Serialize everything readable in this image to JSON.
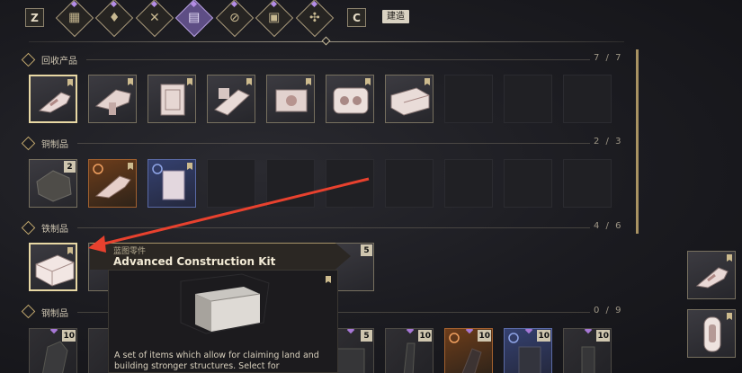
{
  "topbar": {
    "key_left": "Z",
    "key_right": "C",
    "active_label": "建造",
    "tabs": [
      {
        "icon": "grid-icon",
        "glyph": "▦",
        "active": false
      },
      {
        "icon": "drop-icon",
        "glyph": "♦",
        "active": false
      },
      {
        "icon": "tools-icon",
        "glyph": "✕",
        "active": false
      },
      {
        "icon": "bricks-icon",
        "glyph": "▤",
        "active": true
      },
      {
        "icon": "recycle-icon",
        "glyph": "⊘",
        "active": false
      },
      {
        "icon": "crate-icon",
        "glyph": "▣",
        "active": false
      },
      {
        "icon": "molecule-icon",
        "glyph": "✣",
        "active": false
      }
    ]
  },
  "sections": [
    {
      "label": "回收产品",
      "count": "7 / 7"
    },
    {
      "label": "铜制品",
      "count": "2 / 3"
    },
    {
      "label": "铁制品",
      "count": "4 / 6"
    },
    {
      "label": "钢制品",
      "count": "0 / 9"
    }
  ],
  "slot_counts": {
    "copper_first": "2",
    "iron_fourth": "5",
    "steel": [
      "10",
      "10",
      "10",
      "10",
      "5",
      "10",
      "10",
      "10",
      "10"
    ]
  },
  "tooltip": {
    "category": "蓝图零件",
    "title": "Advanced Construction Kit",
    "description": "A set of items which allow for claiming land and building stronger structures. Select for"
  },
  "colors": {
    "accent_gold": "#c2a86e",
    "active_tab": "#5e4e85",
    "arrow": "#e8412e"
  }
}
